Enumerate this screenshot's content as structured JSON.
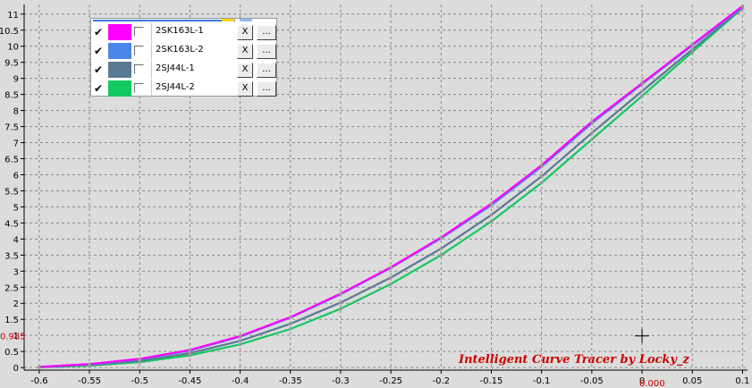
{
  "chart_data": {
    "type": "line",
    "title": "",
    "xlabel": "",
    "ylabel": "",
    "xlim": [
      -0.615,
      0.105
    ],
    "ylim": [
      -0.08,
      11.3
    ],
    "x_ticks": [
      "-0.6",
      "-0.55",
      "-0.5",
      "-0.45",
      "-0.4",
      "-0.35",
      "-0.3",
      "-0.25",
      "-0.2",
      "-0.15",
      "-0.1",
      "-0.05",
      "0",
      "0.05",
      "0.1"
    ],
    "y_ticks": [
      "0",
      "0.5",
      "1",
      "1.5",
      "2",
      "2.5",
      "3",
      "3.5",
      "4",
      "4.5",
      "5",
      "5.5",
      "6",
      "6.5",
      "7",
      "7.5",
      "8",
      "8.5",
      "9",
      "9.5",
      "10",
      "10.5",
      "11"
    ],
    "grid": true,
    "legend_placement": "top-left",
    "series": [
      {
        "name": "2SK163L-1",
        "color": "#ff00ff",
        "points": [
          [
            -0.6,
            0.02
          ],
          [
            -0.55,
            0.11
          ],
          [
            -0.5,
            0.27
          ],
          [
            -0.45,
            0.55
          ],
          [
            -0.4,
            0.98
          ],
          [
            -0.35,
            1.57
          ],
          [
            -0.3,
            2.3
          ],
          [
            -0.25,
            3.12
          ],
          [
            -0.2,
            4.05
          ],
          [
            -0.15,
            5.1
          ],
          [
            -0.1,
            6.3
          ],
          [
            -0.05,
            7.65
          ],
          [
            0,
            8.85
          ],
          [
            0.05,
            10.05
          ],
          [
            0.1,
            11.25
          ]
        ]
      },
      {
        "name": "2SK163L-2",
        "color": "#4a86e8",
        "points": [
          [
            -0.6,
            0.02
          ],
          [
            -0.55,
            0.1
          ],
          [
            -0.5,
            0.26
          ],
          [
            -0.45,
            0.53
          ],
          [
            -0.4,
            0.96
          ],
          [
            -0.35,
            1.55
          ],
          [
            -0.3,
            2.28
          ],
          [
            -0.25,
            3.1
          ],
          [
            -0.2,
            4.02
          ],
          [
            -0.15,
            5.05
          ],
          [
            -0.1,
            6.25
          ],
          [
            -0.05,
            7.6
          ],
          [
            0,
            8.82
          ],
          [
            0.05,
            10.02
          ],
          [
            0.1,
            11.22
          ]
        ]
      },
      {
        "name": "2SJ44L-1",
        "color": "#5a7a94",
        "points": [
          [
            -0.6,
            0.01
          ],
          [
            -0.55,
            0.08
          ],
          [
            -0.5,
            0.21
          ],
          [
            -0.45,
            0.45
          ],
          [
            -0.4,
            0.83
          ],
          [
            -0.35,
            1.36
          ],
          [
            -0.3,
            2.02
          ],
          [
            -0.25,
            2.8
          ],
          [
            -0.2,
            3.7
          ],
          [
            -0.15,
            4.75
          ],
          [
            -0.1,
            5.95
          ],
          [
            -0.05,
            7.3
          ],
          [
            0,
            8.6
          ],
          [
            0.05,
            9.9
          ],
          [
            0.1,
            11.2
          ]
        ]
      },
      {
        "name": "2SJ44L-2",
        "color": "#12c860",
        "points": [
          [
            -0.6,
            0.01
          ],
          [
            -0.55,
            0.06
          ],
          [
            -0.5,
            0.17
          ],
          [
            -0.45,
            0.38
          ],
          [
            -0.4,
            0.72
          ],
          [
            -0.35,
            1.2
          ],
          [
            -0.3,
            1.83
          ],
          [
            -0.25,
            2.6
          ],
          [
            -0.2,
            3.5
          ],
          [
            -0.15,
            4.55
          ],
          [
            -0.1,
            5.75
          ],
          [
            -0.05,
            7.1
          ],
          [
            0,
            8.45
          ],
          [
            0.05,
            9.82
          ],
          [
            0.1,
            11.18
          ]
        ]
      }
    ],
    "annotations": {
      "y_marker_label": "0.985",
      "x_marker_label": "0.000",
      "cursor_point": [
        0.0,
        0.985
      ]
    }
  },
  "legend": {
    "items": [
      {
        "name": "2SK163L-1",
        "color": "#ff00ff",
        "check": "✔",
        "x_label": "X",
        "more_label": "..."
      },
      {
        "name": "2SK163L-2",
        "color": "#4a86e8",
        "check": "✔",
        "x_label": "X",
        "more_label": "..."
      },
      {
        "name": "2SJ44L-1",
        "color": "#5a7a94",
        "check": "✔",
        "x_label": "X",
        "more_label": "..."
      },
      {
        "name": "2SJ44L-2",
        "color": "#12c860",
        "check": "✔",
        "x_label": "X",
        "more_label": "..."
      }
    ]
  },
  "watermark": "Intelligent Curve Tracer by Locky_z",
  "colors": {
    "background": "#dcdcdc",
    "grid": "#8a8a8a",
    "axis": "#000000",
    "marker_text": "#cc0000",
    "point_marker": "#999999"
  }
}
